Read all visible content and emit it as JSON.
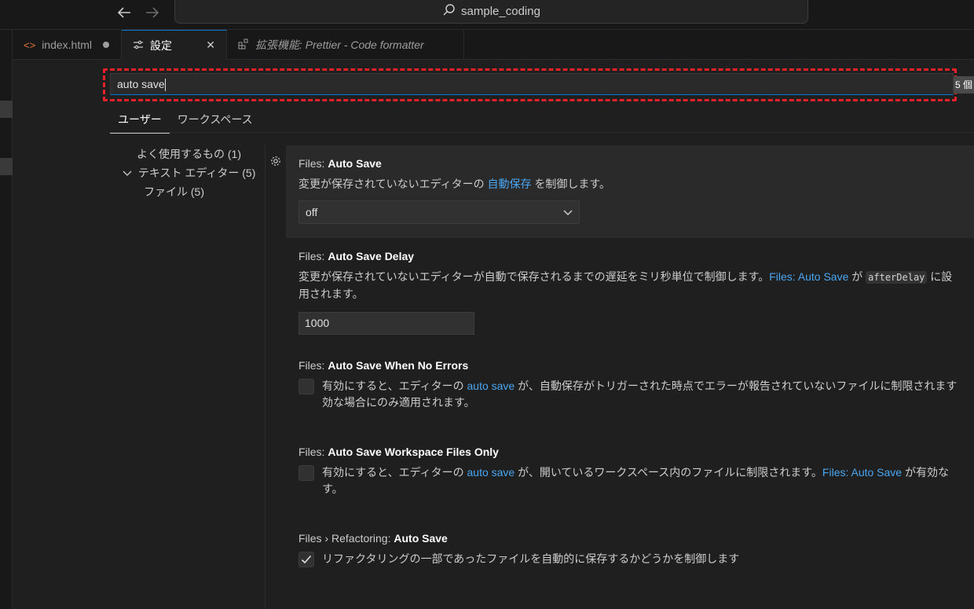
{
  "titlebar": {
    "search_text": "sample_coding"
  },
  "tabs": [
    {
      "label": "index.html",
      "icon": "code-icon"
    },
    {
      "label": "設定",
      "icon": "settings-sliders-icon",
      "close": "✕"
    },
    {
      "label": "拡張機能: Prettier - Code formatter",
      "icon": "extensions-icon"
    }
  ],
  "search": {
    "value": "auto save",
    "result_count": "5 個"
  },
  "scopes": [
    "ユーザー",
    "ワークスペース"
  ],
  "toc": [
    {
      "label": "よく使用するもの (1)"
    },
    {
      "label": "テキスト エディター (5)",
      "expanded": true
    },
    {
      "label": "ファイル (5)"
    }
  ],
  "settings": {
    "auto_save": {
      "category": "Files: ",
      "name": "Auto Save",
      "desc_a": "変更が保存されていないエディターの ",
      "desc_link": "自動保存",
      "desc_b": " を制御します。",
      "value": "off"
    },
    "auto_save_delay": {
      "category": "Files: ",
      "name": "Auto Save Delay",
      "desc_a": "変更が保存されていないエディターが自動で保存されるまでの遅延をミリ秒単位で制御します。",
      "desc_link": "Files: Auto Save",
      "desc_b": " が ",
      "desc_code": "afterDelay",
      "desc_c": " に設",
      "desc_d": "用されます。",
      "value": "1000"
    },
    "auto_save_no_errors": {
      "category": "Files: ",
      "name": "Auto Save When No Errors",
      "desc_a": "有効にすると、エディターの ",
      "desc_link": "auto save",
      "desc_b": " が、自動保存がトリガーされた時点でエラーが報告されていないファイルに制限されます",
      "desc_c": "効な場合にのみ適用されます。",
      "checked": false
    },
    "auto_save_workspace": {
      "category": "Files: ",
      "name": "Auto Save Workspace Files Only",
      "desc_a": "有効にすると、エディターの ",
      "desc_link": "auto save",
      "desc_b": " が、開いているワークスペース内のファイルに制限されます。",
      "desc_link2": "Files: Auto Save",
      "desc_c": " が有効な",
      "desc_d": "す。",
      "checked": false
    },
    "refactoring_auto_save": {
      "category": "Files › Refactoring: ",
      "name": "Auto Save",
      "desc_a": "リファクタリングの一部であったファイルを自動的に保存するかどうかを制御します",
      "checked": true
    }
  },
  "colors": {
    "accent": "#0078d4",
    "link": "#4aa5f0",
    "highlight": "#e8202a"
  }
}
